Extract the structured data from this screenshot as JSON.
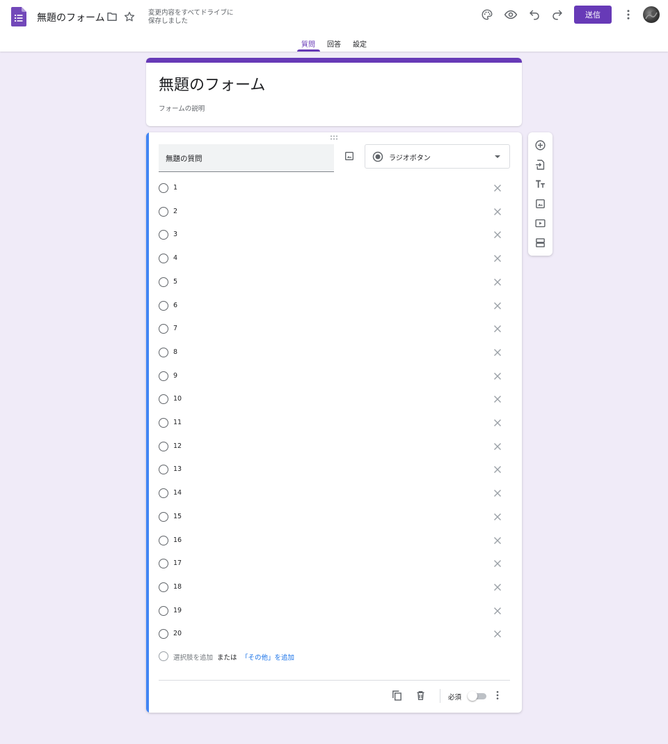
{
  "header": {
    "doc_title": "無題のフォーム",
    "save_status": "変更内容をすべてドライブに保存しました",
    "send_label": "送信",
    "icons": [
      "forms-logo-icon",
      "folder-icon",
      "star-icon",
      "palette-icon",
      "preview-eye-icon",
      "undo-icon",
      "redo-icon",
      "more-vert-icon"
    ]
  },
  "tabs": [
    {
      "label": "質問",
      "active": true
    },
    {
      "label": "回答",
      "active": false
    },
    {
      "label": "設定",
      "active": false
    }
  ],
  "form": {
    "title": "無題のフォーム",
    "description_placeholder": "フォームの説明"
  },
  "question": {
    "title": "無題の質問",
    "type_label": "ラジオボタン",
    "options": [
      "1",
      "2",
      "3",
      "4",
      "5",
      "6",
      "7",
      "8",
      "9",
      "10",
      "11",
      "12",
      "13",
      "14",
      "15",
      "16",
      "17",
      "18",
      "19",
      "20"
    ],
    "add_option": "選択肢を追加",
    "or_text": "または",
    "add_other": "「その他」を追加",
    "required_label": "必須",
    "required": false
  },
  "side_toolbar": [
    "add-question-icon",
    "import-questions-icon",
    "add-title-icon",
    "add-image-icon",
    "add-video-icon",
    "add-section-icon"
  ],
  "colors": {
    "accent": "#673ab7",
    "background": "#f0ebf8",
    "active_card_bar": "#4285f4",
    "link": "#1a73e8"
  }
}
